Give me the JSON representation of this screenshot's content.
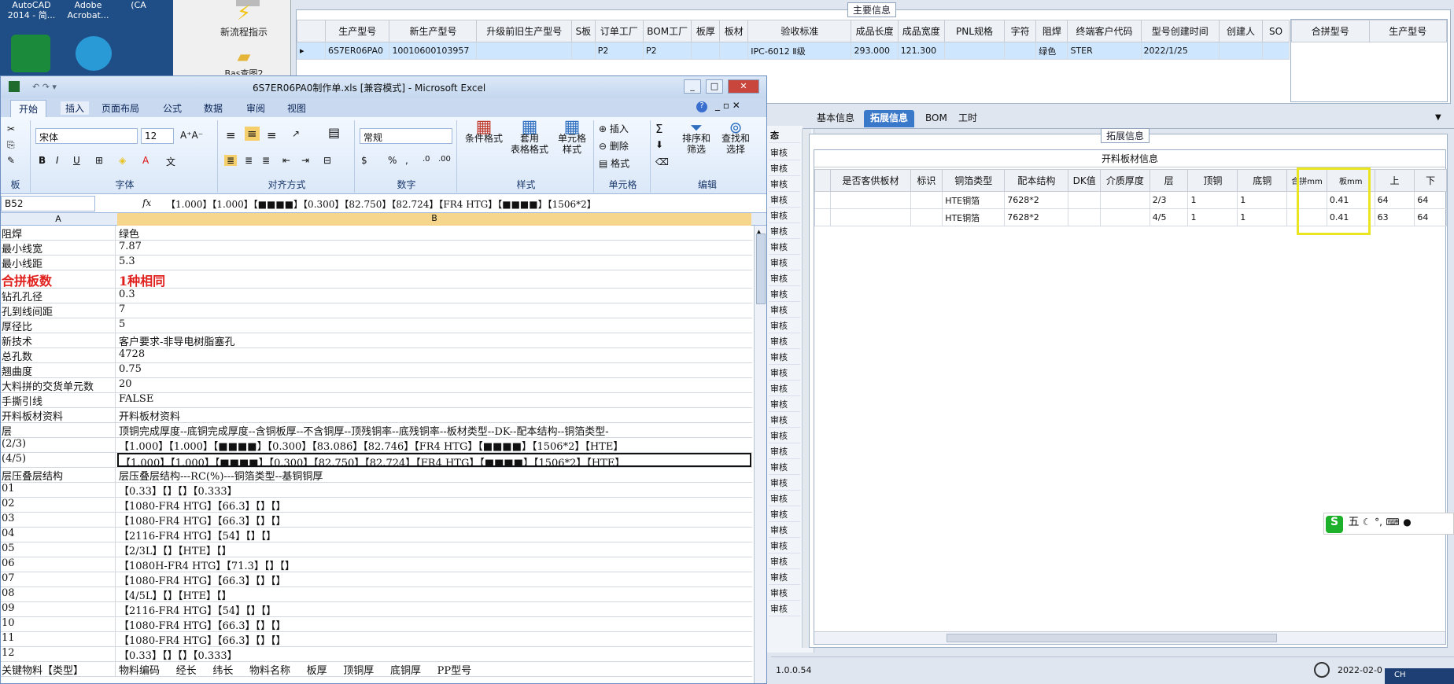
{
  "desktop": {
    "icons": [
      {
        "label": "AutoCAD 2014 - 简..."
      },
      {
        "label": "Adobe Acrobat..."
      },
      {
        "label": "(CA"
      }
    ],
    "flow_label": "新流程指示",
    "folder_label": "Bas查图2"
  },
  "erp": {
    "main_title": "主要信息",
    "main_headers": [
      "生产型号",
      "新生产型号",
      "升级前旧生产型号",
      "S板",
      "订单工厂",
      "BOM工厂",
      "板厚",
      "板材",
      "验收标准",
      "成品长度",
      "成品宽度",
      "PNL规格",
      "字符",
      "阻焊",
      "终端客户代码",
      "型号创建时间",
      "创建人",
      "SO"
    ],
    "main_row": [
      "6S7ER06PA0",
      "10010600103957",
      "",
      "",
      "P2",
      "P2",
      "",
      "",
      "IPC-6012 Ⅱ级",
      "293.000",
      "121.300",
      "",
      "",
      "绿色",
      "STER",
      "2022/1/25",
      "",
      ""
    ],
    "right_headers": [
      "合拼型号",
      "生产型号"
    ],
    "tabs": [
      "基本信息",
      "拓展信息",
      "BOM",
      "工时"
    ],
    "ext_title": "拓展信息",
    "inner_title": "开料板材信息",
    "inner_headers": [
      "是否客供板材",
      "标识",
      "铜箔类型",
      "配本结构",
      "DK值",
      "介质厚度",
      "层",
      "顶铜",
      "底铜",
      "合拼mm",
      "板mm",
      "上",
      "下"
    ],
    "inner_rows": [
      [
        "",
        "",
        "HTE铜箔",
        "7628*2",
        "",
        "",
        "2/3",
        "1",
        "1",
        "",
        "0.41",
        "64",
        "64"
      ],
      [
        "",
        "",
        "HTE铜箔",
        "7628*2",
        "",
        "",
        "4/5",
        "1",
        "1",
        "",
        "0.41",
        "63",
        "64"
      ]
    ],
    "mid_label": "审核",
    "status_label": "态",
    "version": "1.0.0.54",
    "date": "2022-02-0",
    "lang": "CH",
    "ime_label": "五"
  },
  "excel": {
    "title": "6S7ER06PA0制作单.xls [兼容模式] - Microsoft Excel",
    "ribbon_tabs": [
      "开始",
      "插入",
      "页面布局",
      "公式",
      "数据",
      "审阅",
      "视图"
    ],
    "font_name": "宋体",
    "font_size": "12",
    "number_format": "常规",
    "group_labels": [
      "板",
      "字体",
      "对齐方式",
      "数字",
      "样式",
      "单元格",
      "编辑"
    ],
    "style_buttons": [
      "条件格式",
      "套用\n表格格式",
      "单元格\n样式"
    ],
    "cell_buttons": [
      "插入",
      "删除",
      "格式"
    ],
    "edit_buttons": [
      "排序和\n筛选",
      "查找和\n选择"
    ],
    "name_box": "B52",
    "formula": "【1.000】【1.000】【■■■■】【0.300】【82.750】【82.724】【FR4 HTG】【■■■■】【1506*2】",
    "col_a": "A",
    "col_b": "B",
    "rows": [
      [
        "阻焊",
        "绿色"
      ],
      [
        "最小线宽",
        "7.87"
      ],
      [
        "最小线距",
        "5.3"
      ],
      [
        "合拼板数",
        "1种相同"
      ],
      [
        "钻孔孔径",
        "0.3"
      ],
      [
        "孔到线间距",
        "7"
      ],
      [
        "厚径比",
        "5"
      ],
      [
        "新技术",
        "客户要求-非导电树脂塞孔"
      ],
      [
        "总孔数",
        "4728"
      ],
      [
        "翘曲度",
        "0.75"
      ],
      [
        "大料拼的交货单元数",
        "20"
      ],
      [
        "手撕引线",
        "FALSE"
      ],
      [
        "开料板材资料",
        "开料板材资料"
      ],
      [
        "层",
        "顶铜完成厚度--底铜完成厚度--含铜板厚--不含铜厚--顶残铜率--底残铜率--板材类型--DK--配本结构--铜箔类型-"
      ],
      [
        "(2/3)",
        "【1.000】【1.000】【■■■■】【0.300】【83.086】【82.746】【FR4 HTG】【■■■■】【1506*2】【HTE】"
      ],
      [
        "(4/5)",
        "【1.000】【1.000】【■■■■】【0.300】【82.750】【82.724】【FR4 HTG】【■■■■】【1506*2】【HTE】"
      ],
      [
        "层压叠层结构",
        "层压叠层结构---RC(%)---铜箔类型--基铜铜厚"
      ],
      [
        "01",
        "【0.33】【】【】【0.333】"
      ],
      [
        "02",
        "【1080-FR4 HTG】【66.3】【】【】"
      ],
      [
        "03",
        "【1080-FR4 HTG】【66.3】【】【】"
      ],
      [
        "04",
        "【2116-FR4 HTG】【54】【】【】"
      ],
      [
        "05",
        "【2/3L】【】【HTE】【】"
      ],
      [
        "06",
        "【1080H-FR4 HTG】【71.3】【】【】"
      ],
      [
        "07",
        "【1080-FR4 HTG】【66.3】【】【】"
      ],
      [
        "08",
        "【4/5L】【】【HTE】【】"
      ],
      [
        "09",
        "【2116-FR4 HTG】【54】【】【】"
      ],
      [
        "10",
        "【1080-FR4 HTG】【66.3】【】【】"
      ],
      [
        "11",
        "【1080-FR4 HTG】【66.3】【】【】"
      ],
      [
        "12",
        "【0.33】【】【】【0.333】"
      ],
      [
        "关键物料【类型】",
        "物料编码     经长     纬长     物料名称     板厚     顶铜厚     底铜厚     PP型号"
      ]
    ]
  },
  "colors": {
    "highlight": "#e9e61f",
    "accent": "#3a78c9",
    "red": "#e0201c"
  }
}
